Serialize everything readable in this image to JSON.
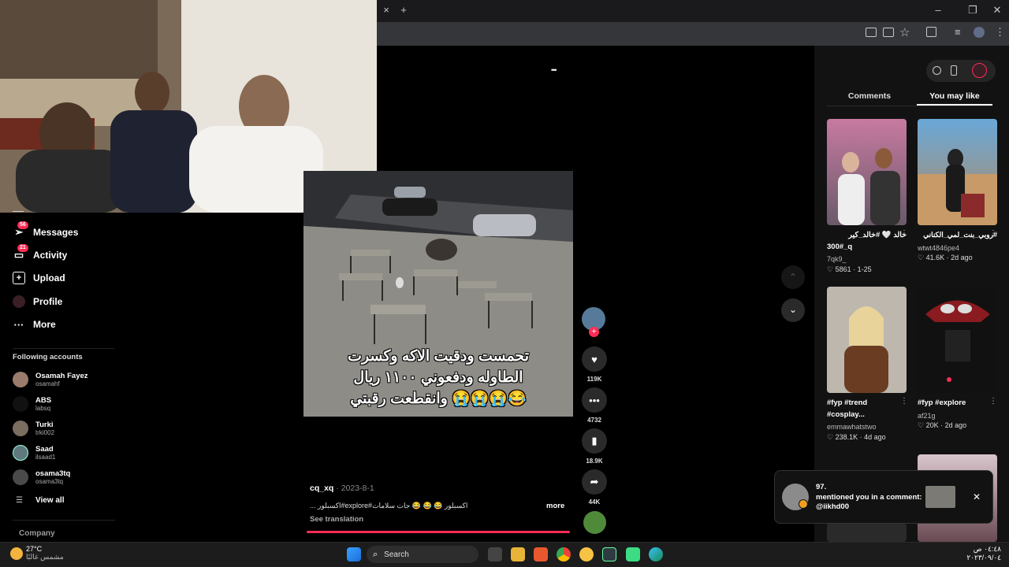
{
  "browser": {
    "close_tab": "×",
    "new_tab": "+",
    "toolbar_icons": [
      "translate-icon",
      "cast-icon",
      "star-icon",
      "extensions-icon",
      "media-icon",
      "profile-icon",
      "menu-icon"
    ],
    "window_controls": {
      "minimize": "–",
      "restore": "❐",
      "close": "✕"
    }
  },
  "sidebar": {
    "nav": [
      {
        "label": "Messages",
        "badge": "56",
        "icon": "messages-icon"
      },
      {
        "label": "Activity",
        "badge": "21",
        "icon": "activity-icon"
      },
      {
        "label": "Upload",
        "badge": "",
        "icon": "upload-icon"
      },
      {
        "label": "Profile",
        "badge": "",
        "icon": "profile-icon"
      },
      {
        "label": "More",
        "badge": "",
        "icon": "more-icon"
      }
    ],
    "following_header": "Following accounts",
    "accounts": [
      {
        "name": "Osamah Fayez",
        "handle": "osamahf"
      },
      {
        "name": "ABS",
        "handle": "labsq"
      },
      {
        "name": "Turki",
        "handle": "trki002"
      },
      {
        "name": "Saad",
        "handle": "ilsaad1"
      },
      {
        "name": "osama3tq",
        "handle": "osama3tq"
      }
    ],
    "view_all": "View all",
    "company": "Company"
  },
  "video": {
    "more_dots": "•••",
    "caption_lines": [
      "تحمست ودقيت الاكه وكسرت",
      "الطاوله ودفعوني ١١٠٠ ريال",
      "وانقطعت رقبتي 😭😭😭😂"
    ],
    "author": "cq_xq",
    "date": "· 2023-8-1",
    "description": "... اكسبلور#explore#اكسبلور 😂 😂 😂 جات سلامات",
    "more": "more",
    "see_translation": "See translation",
    "likes": "119K",
    "comments": "4732",
    "saves": "18.9K",
    "shares": "44K"
  },
  "right_panel": {
    "tabs": [
      "Comments",
      "You may like"
    ],
    "active_tab": "You may like",
    "cards": [
      {
        "title": "خالد 🤍 #خالد_كير",
        "title2": "300#_q",
        "user": "7qk9_",
        "likes": "5861",
        "ago": "1-25"
      },
      {
        "title": "#روبي_بنت_لمي_الكناني",
        "title2": "",
        "user": "wtwt4846pe4",
        "likes": "41.6K",
        "ago": "2d ago"
      },
      {
        "title": "#fyp #trend",
        "title2": "#cosplay...",
        "user": "emmawhatstwo",
        "likes": "238.1K",
        "ago": "4d ago"
      },
      {
        "title": "#fyp #explore",
        "title2": "",
        "user": "af21g",
        "likes": "20K",
        "ago": "2d ago"
      }
    ]
  },
  "notification": {
    "name": "97.",
    "text": "mentioned you in a comment: @iikhd00",
    "close": "✕"
  },
  "taskbar": {
    "weather_temp": "27°C",
    "weather_desc": "مشمس غالبًا",
    "search_placeholder": "Search",
    "time": "٠٤:٤٨ ص",
    "date": "٢٠٢٣/٠٩/٠٤"
  },
  "colors": {
    "accent": "#fe2c55",
    "bg": "#000000",
    "panel": "#121212"
  }
}
